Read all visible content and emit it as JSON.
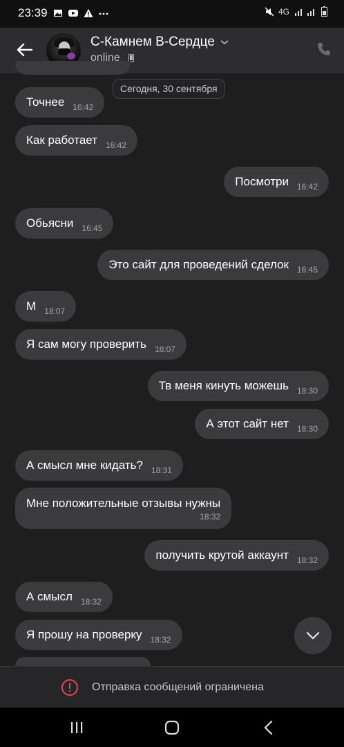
{
  "status_bar": {
    "time": "23:39",
    "network": "4G",
    "icons": [
      "gallery-icon",
      "youtube-icon",
      "warning-icon",
      "more-dots-icon",
      "mute-icon",
      "signal-icon",
      "battery-icon"
    ]
  },
  "header": {
    "contact_name": "С-Камнем В-Сердце",
    "status": "online"
  },
  "date_separator": "Сегодня, 30 сентября",
  "messages": [
    {
      "text": "Точнее",
      "time": "16:42",
      "side": "in"
    },
    {
      "text": "Как работает",
      "time": "16:42",
      "side": "in"
    },
    {
      "text": "Посмотри",
      "time": "16:42",
      "side": "out"
    },
    {
      "text": "Обьясни",
      "time": "16:45",
      "side": "in"
    },
    {
      "text": "Это сайт для проведений сделок",
      "time": "16:45",
      "side": "out"
    },
    {
      "text": "М",
      "time": "18:07",
      "side": "in"
    },
    {
      "text": "Я сам могу проверить",
      "time": "18:07",
      "side": "in"
    },
    {
      "text": "Тв меня кинуть можешь",
      "time": "18:30",
      "side": "out"
    },
    {
      "text": "А этот сайт нет",
      "time": "18:30",
      "side": "out"
    },
    {
      "text": "А смысл мне кидать?",
      "time": "18:31",
      "side": "in"
    },
    {
      "text": "Мне положительные отзывы нужны",
      "time": "18:32",
      "side": "in"
    },
    {
      "text": "получить крутой аккаунт",
      "time": "18:32",
      "side": "out"
    },
    {
      "text": "А смысл",
      "time": "18:32",
      "side": "in"
    },
    {
      "text": "Я прошу на проверку",
      "time": "18:32",
      "side": "in"
    }
  ],
  "restriction_notice": "Отправка сообщений ограничена",
  "colors": {
    "background": "#1e1e1f",
    "header": "#2d2d2f",
    "bubble": "#3b3b3e",
    "warning": "#e5484d"
  }
}
